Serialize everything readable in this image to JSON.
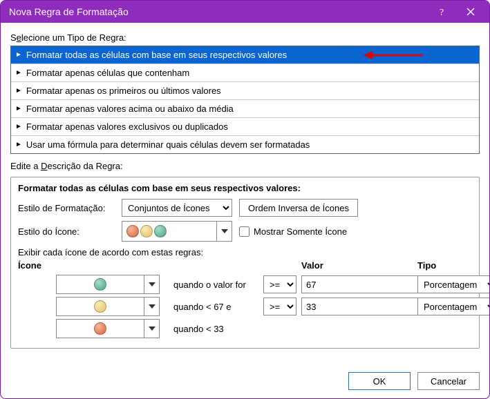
{
  "titlebar": {
    "title": "Nova Regra de Formatação"
  },
  "section1": {
    "label_pre": "S",
    "label_u": "e",
    "label_post": "lecione um Tipo de Regra:"
  },
  "rules": [
    "Formatar todas as células com base em seus respectivos valores",
    "Formatar apenas células que contenham",
    "Formatar apenas os primeiros ou últimos valores",
    "Formatar apenas valores acima ou abaixo da média",
    "Formatar apenas valores exclusivos ou duplicados",
    "Usar uma fórmula para determinar quais células devem ser formatadas"
  ],
  "section2": {
    "label_pre": "Edite a ",
    "label_u": "D",
    "label_post": "escrição da Regra:"
  },
  "desc": {
    "heading": "Formatar todas as células com base em seus respectivos valores:",
    "formatStyleLabel": "Estilo de Formatação:",
    "formatStyleValue": "Conjuntos de Ícones",
    "reverseBtn": "Ordem Inversa de Ícones",
    "iconStyleLabel": "Estilo do Ícone:",
    "showOnlyIcon": "Mostrar Somente Ícone",
    "rulesSub": "Exibir cada ícone de acordo com estas regras:",
    "hdrIcon": "Ícone",
    "hdrValor": "Valor",
    "hdrTipo": "Tipo",
    "row1": {
      "cond": "quando o valor for",
      "op": ">=",
      "val": "67",
      "tipo": "Porcentagem"
    },
    "row2": {
      "cond": "quando < 67 e",
      "op": ">=",
      "val": "33",
      "tipo": "Porcentagem"
    },
    "row3": {
      "cond": "quando < 33"
    }
  },
  "footer": {
    "ok": "OK",
    "cancel": "Cancelar"
  }
}
